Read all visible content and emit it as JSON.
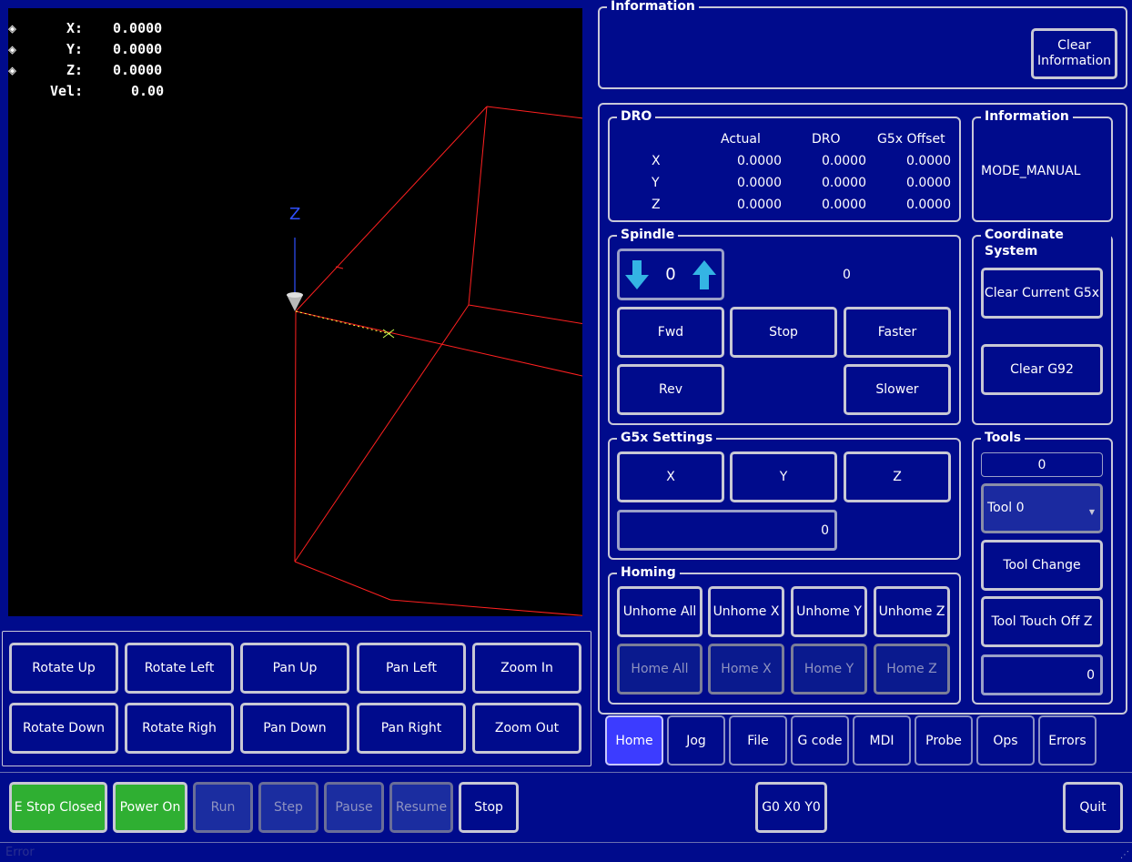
{
  "viewport": {
    "dro": [
      {
        "axis": "X:",
        "value": "0.0000"
      },
      {
        "axis": "Y:",
        "value": "0.0000"
      },
      {
        "axis": "Z:",
        "value": "0.0000"
      }
    ],
    "vel_label": "Vel:",
    "vel_value": "0.00",
    "z_axis_label": "Z"
  },
  "view_buttons": [
    "Rotate Up",
    "Rotate Left",
    "Pan Up",
    "Pan Left",
    "Zoom In",
    "Rotate Down",
    "Rotate Righ",
    "Pan Down",
    "Pan Right",
    "Zoom Out"
  ],
  "info_top": {
    "title": "Information",
    "clear_button": "Clear\nInformation"
  },
  "dro_panel": {
    "title": "DRO",
    "headers": [
      "Actual",
      "DRO",
      "G5x Offset"
    ],
    "rows": [
      {
        "axis": "X",
        "actual": "0.0000",
        "dro": "0.0000",
        "offset": "0.0000"
      },
      {
        "axis": "Y",
        "actual": "0.0000",
        "dro": "0.0000",
        "offset": "0.0000"
      },
      {
        "axis": "Z",
        "actual": "0.0000",
        "dro": "0.0000",
        "offset": "0.0000"
      }
    ]
  },
  "info_side": {
    "title": "Information",
    "mode": "MODE_MANUAL"
  },
  "spindle": {
    "title": "Spindle",
    "speed": "0",
    "speed_display": "0",
    "fwd": "Fwd",
    "stop": "Stop",
    "faster": "Faster",
    "rev": "Rev",
    "slower": "Slower"
  },
  "coord_system": {
    "title": "Coordinate System",
    "clear_g5x": "Clear Current G5x",
    "clear_g92": "Clear G92"
  },
  "g5x": {
    "title": "G5x Settings",
    "x": "X",
    "y": "Y",
    "z": "Z",
    "value": "0"
  },
  "tools": {
    "title": "Tools",
    "tool_number": "0",
    "tool_select": "Tool 0",
    "tool_change": "Tool Change",
    "touch_off": "Tool Touch Off Z",
    "touch_value": "0"
  },
  "homing": {
    "title": "Homing",
    "unhome": [
      "Unhome All",
      "Unhome X",
      "Unhome Y",
      "Unhome Z"
    ],
    "home": [
      "Home All",
      "Home X",
      "Home Y",
      "Home Z"
    ]
  },
  "tabs": [
    "Home",
    "Jog",
    "File",
    "G code",
    "MDI",
    "Probe",
    "Ops",
    "Errors"
  ],
  "active_tab": "Home",
  "bottom_bar": {
    "estop": "E Stop Closed",
    "power": "Power On",
    "run": "Run",
    "step": "Step",
    "pause": "Pause",
    "resume": "Resume",
    "stop": "Stop",
    "g0": "G0 X0 Y0",
    "quit": "Quit"
  },
  "status_bar": "Error",
  "colors": {
    "background": "#000b8c",
    "active_green": "#2faf32",
    "active_tab": "#3c3cff",
    "toolpath": "#ff2020",
    "z_axis": "#3050ff"
  }
}
